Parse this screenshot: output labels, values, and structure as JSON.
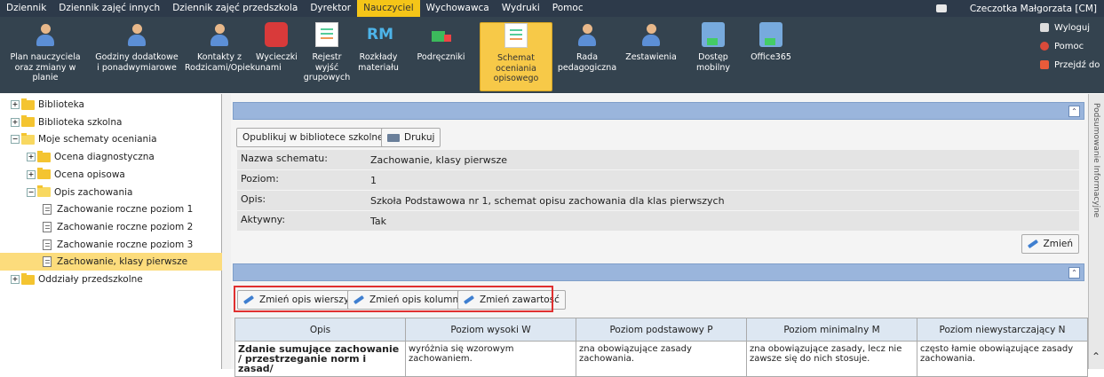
{
  "menu": {
    "items": [
      "Dziennik",
      "Dziennik zajęć innych",
      "Dziennik zajęć przedszkola",
      "Dyrektor",
      "Nauczyciel",
      "Wychowawca",
      "Wydruki",
      "Pomoc"
    ],
    "active": "Nauczyciel",
    "user": "Czeczotka Małgorzata [CM]"
  },
  "toolbar": {
    "buttons": [
      {
        "label": "Plan nauczyciela oraz zmiany w planie",
        "icon": "teacher-plan-icon"
      },
      {
        "label": "Godziny dodatkowe i ponadwymiarowe",
        "icon": "extra-hours-icon"
      },
      {
        "label": "Kontakty z Rodzicami/Opiekunami",
        "icon": "parents-contacts-icon"
      },
      {
        "label": "Wycieczki",
        "icon": "backpack-icon"
      },
      {
        "label": "Rejestr wyjść grupowych",
        "icon": "group-exits-icon"
      },
      {
        "label": "Rozkłady materiału",
        "icon": "rm-icon"
      },
      {
        "label": "Podręczniki",
        "icon": "textbooks-icon"
      },
      {
        "label": "Schemat oceniania opisowego",
        "icon": "evaluation-scheme-icon",
        "active": true
      },
      {
        "label": "Rada pedagogiczna",
        "icon": "council-icon"
      },
      {
        "label": "Zestawienia",
        "icon": "statements-icon"
      },
      {
        "label": "Dostęp mobilny",
        "icon": "mobile-icon"
      },
      {
        "label": "Office365",
        "icon": "office365-icon"
      }
    ],
    "right": {
      "logout": "Wyloguj",
      "help": "Pomoc",
      "goto": "Przejdź do"
    }
  },
  "tree": [
    {
      "label": "Biblioteka",
      "level": 0,
      "kind": "folder",
      "expanded": false
    },
    {
      "label": "Biblioteka szkolna",
      "level": 0,
      "kind": "folder",
      "expanded": false
    },
    {
      "label": "Moje schematy oceniania",
      "level": 0,
      "kind": "folder",
      "expanded": true
    },
    {
      "label": "Ocena diagnostyczna",
      "level": 1,
      "kind": "folder",
      "expanded": false
    },
    {
      "label": "Ocena opisowa",
      "level": 1,
      "kind": "folder",
      "expanded": false
    },
    {
      "label": "Opis zachowania",
      "level": 1,
      "kind": "folder",
      "expanded": true
    },
    {
      "label": "Zachowanie roczne poziom 1",
      "level": 2,
      "kind": "file"
    },
    {
      "label": "Zachowanie roczne poziom 2",
      "level": 2,
      "kind": "file"
    },
    {
      "label": "Zachowanie roczne poziom 3",
      "level": 2,
      "kind": "file"
    },
    {
      "label": "Zachowanie, klasy pierwsze",
      "level": 2,
      "kind": "file",
      "selected": true
    },
    {
      "label": "Oddziały przedszkolne",
      "level": 0,
      "kind": "folder",
      "expanded": false
    }
  ],
  "details": {
    "publish_label": "Opublikuj w bibliotece szkolnej",
    "print_label": "Drukuj",
    "fields": [
      {
        "key": "Nazwa schematu:",
        "value": "Zachowanie, klasy pierwsze"
      },
      {
        "key": "Poziom:",
        "value": "1"
      },
      {
        "key": "Opis:",
        "value": "Szkoła Podstawowa nr 1, schemat opisu zachowania dla klas pierwszych"
      },
      {
        "key": "Aktywny:",
        "value": "Tak"
      }
    ],
    "change_label": "Zmień"
  },
  "matrix": {
    "actions": [
      "Zmień opis wierszy",
      "Zmień opis kolumn",
      "Zmień zawartość"
    ],
    "columns": [
      "Opis",
      "Poziom wysoki W",
      "Poziom podstawowy P",
      "Poziom minimalny M",
      "Poziom niewystarczający N"
    ],
    "rows": [
      [
        "Zdanie sumujące zachowanie / przestrzeganie norm i zasad/",
        "wyróżnia się wzorowym zachowaniem.",
        "zna obowiązujące zasady zachowania.",
        "zna obowiązujące zasady, lecz nie zawsze się do nich stosuje.",
        "często łamie obowiązujące zasady zachowania."
      ]
    ]
  },
  "side_tab": "Podsumowanie Informacyjne",
  "colors": {
    "menubar": "#2d3a4a",
    "toolbar": "#34434f",
    "active": "#f7c948",
    "panel_header": "#9ab5dc",
    "highlight_box": "#e03030"
  }
}
